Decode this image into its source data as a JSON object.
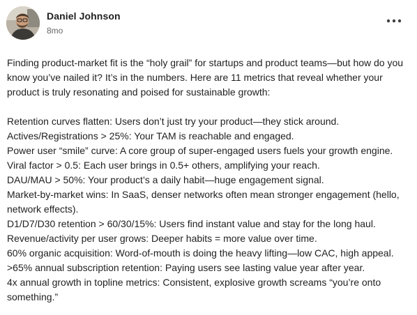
{
  "post": {
    "author_name": "Daniel Johnson",
    "timestamp": "8mo",
    "more_icon": "more-horizontal-icon",
    "intro": "Finding product-market fit is the “holy grail” for startups and product teams—but how do you know you’ve nailed it? It’s in the numbers. Here are 11 metrics that reveal whether your product is truly resonating and poised for sustainable growth:",
    "metrics": [
      "Retention curves flatten: Users don’t just try your product—they stick around.",
      "Actives/Registrations > 25%: Your TAM is reachable and engaged.",
      "Power user “smile” curve: A core group of super-engaged users fuels your growth engine.",
      "Viral factor > 0.5: Each user brings in 0.5+ others, amplifying your reach.",
      "DAU/MAU > 50%: Your product’s a daily habit—huge engagement signal.",
      "Market-by-market wins: In SaaS, denser networks often mean stronger engagement (hello, network effects).",
      "D1/D7/D30 retention > 60/30/15%: Users find instant value and stay for the long haul.",
      "Revenue/activity per user grows: Deeper habits = more value over time.",
      "60% organic acquisition: Word-of-mouth is doing the heavy lifting—low CAC, high appeal.",
      ">65% annual subscription retention: Paying users see lasting value year after year.",
      "4x annual growth in topline metrics: Consistent, explosive growth screams “you’re onto something.”"
    ]
  },
  "colors": {
    "text_primary": "#1f1f1f",
    "text_secondary": "#666666",
    "background": "#ffffff"
  }
}
